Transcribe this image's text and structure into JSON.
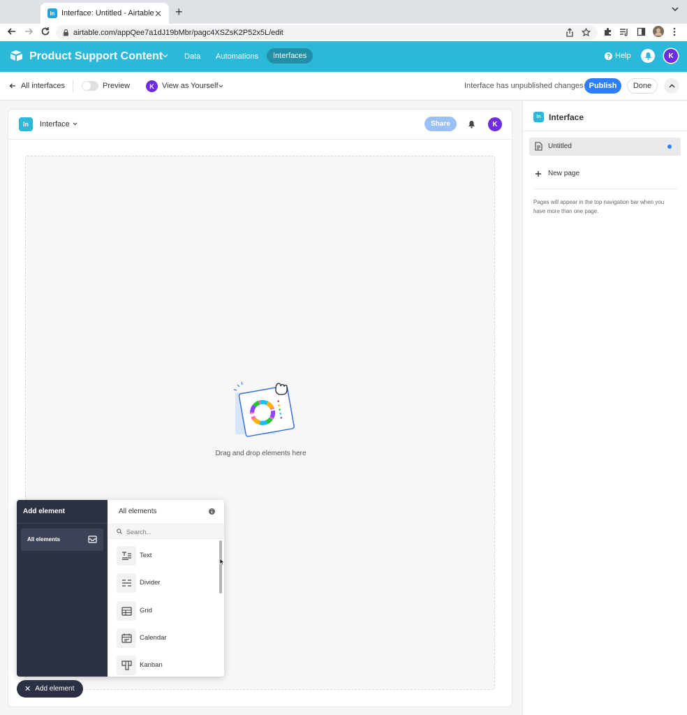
{
  "browser": {
    "tab_title": "Interface: Untitled - Airtable",
    "tab_favicon": "In",
    "url": "airtable.com/appQee7a1dJ19bMbr/pagc4XSZsK2P52x5L/edit"
  },
  "app": {
    "base_name": "Product Support Content",
    "nav": {
      "data": "Data",
      "automations": "Automations",
      "interfaces": "Interfaces"
    },
    "help": "Help",
    "avatar": "K",
    "brand_color": "#2cb8d8"
  },
  "toolbar": {
    "all_interfaces": "All interfaces",
    "preview": "Preview",
    "view_as_avatar": "K",
    "view_as": "View as Yourself",
    "unpublished": "Interface has unpublished changes",
    "publish": "Publish",
    "done": "Done"
  },
  "page": {
    "badge": "In",
    "title": "Interface",
    "share": "Share",
    "avatar": "K",
    "dropzone_text": "Drag and drop elements here"
  },
  "sidebar": {
    "badge": "In",
    "title": "Interface",
    "pages": [
      {
        "label": "Untitled"
      }
    ],
    "new_page": "New page",
    "help_text": "Pages will appear in the top navigation bar when you have more than one page."
  },
  "add_element_panel": {
    "title": "Add element",
    "categories": [
      {
        "label": "All elements"
      }
    ],
    "list_title": "All elements",
    "search_placeholder": "Search...",
    "elements": [
      {
        "label": "Text",
        "icon": "text-icon"
      },
      {
        "label": "Divider",
        "icon": "divider-icon"
      },
      {
        "label": "Grid",
        "icon": "grid-icon"
      },
      {
        "label": "Calendar",
        "icon": "calendar-icon"
      },
      {
        "label": "Kanban",
        "icon": "kanban-icon"
      }
    ],
    "toggle_button": "Add element"
  }
}
